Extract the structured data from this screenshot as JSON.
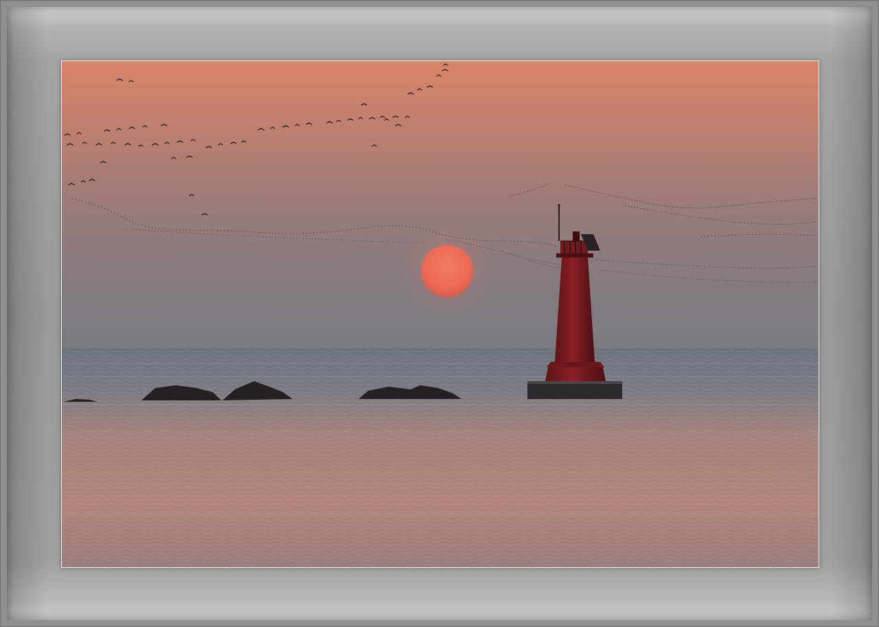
{
  "scene": {
    "subject": "lighthouse",
    "colors": {
      "sky_top": "#d98468",
      "sky_mid": "#a97c75",
      "sky_horizon": "#7e7b80",
      "sea_top": "#7b7f88",
      "sea_bottom": "#b48578",
      "sun": "#f06e58",
      "lighthouse": "#8c1f24",
      "rock": "#2a2628",
      "frame": "#9a9a9a"
    }
  }
}
